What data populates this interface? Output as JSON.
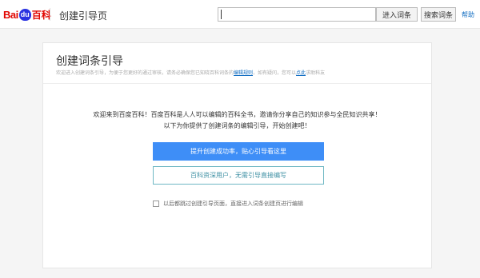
{
  "header": {
    "logo_bai": "Bai",
    "logo_du": "du",
    "logo_baike": "百科",
    "page_title": "创建引导页",
    "search_value": "",
    "enter_button": "进入词条",
    "search_button": "搜索词条",
    "help_link": "帮助"
  },
  "card": {
    "title": "创建词条引导",
    "subtitle_pre": "欢迎进入创建词条引导，为便于您更好的通过审核，请务必确保您已知晓百科词条的",
    "subtitle_link1": "编辑规则",
    "subtitle_mid": "，如有疑问，您可以",
    "subtitle_link2": "点此",
    "subtitle_post": "求助科友"
  },
  "main": {
    "welcome_line1": "欢迎来到百度百科！百度百科是人人可以编辑的百科全书，邀请你分享自己的知识参与全民知识共享！",
    "welcome_line2": "以下为你提供了创建词条的编辑引导，开始创建吧！",
    "primary_button": "提升创建成功率，贴心引导看这里",
    "secondary_button": "百科资深用户，无需引导直接编写",
    "skip_label": "以后都跳过创建引导页面，直接进入词条创建页进行编辑"
  }
}
